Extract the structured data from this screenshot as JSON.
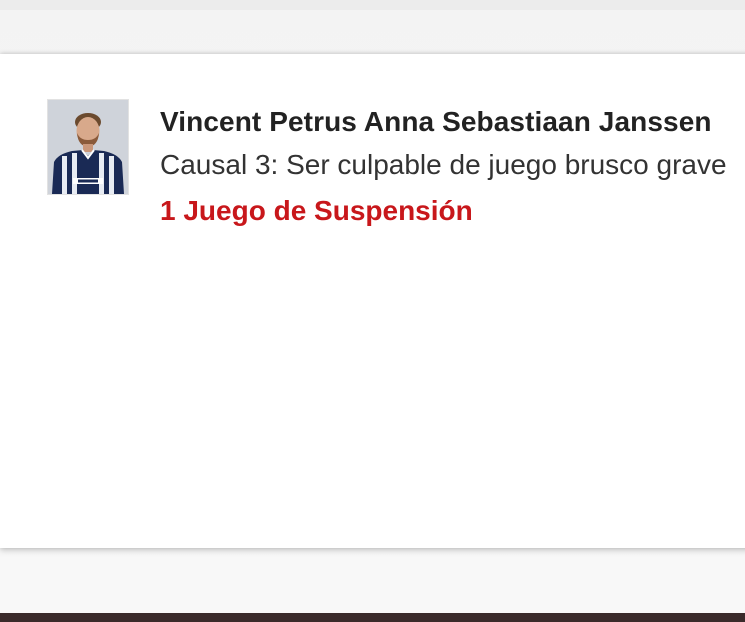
{
  "sanction": {
    "player_name": "Vincent Petrus Anna Sebastiaan Janssen",
    "reason": "Causal 3: Ser culpable de juego brusco grave",
    "suspension": "1 Juego de Suspensión",
    "avatar_icon": "player-photo",
    "colors": {
      "suspension_red": "#c8171b",
      "name_text": "#222222",
      "bottom_bar": "#3a2a2a"
    }
  }
}
